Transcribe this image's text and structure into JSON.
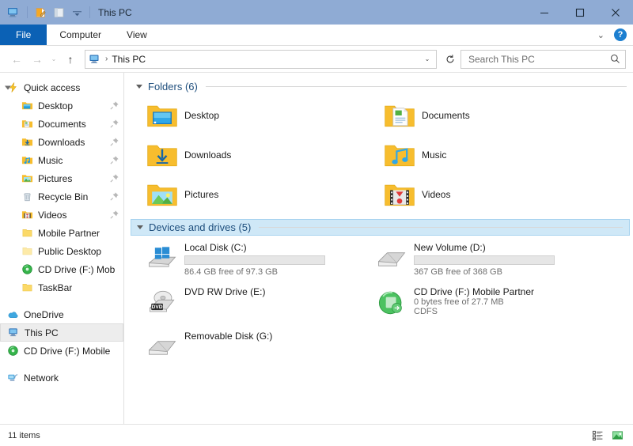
{
  "window": {
    "title": "This PC",
    "qat": [
      {
        "name": "properties-icon",
        "glyph": "properties"
      },
      {
        "name": "new-folder-icon",
        "glyph": "newfolder"
      },
      {
        "name": "customize-qat-dropdown",
        "glyph": "caret"
      }
    ],
    "controls": {
      "minimize": "—",
      "maximize": "☐",
      "close": "✕"
    }
  },
  "ribbon": {
    "tabs": [
      {
        "label": "File",
        "active": true
      },
      {
        "label": "Computer",
        "active": false
      },
      {
        "label": "View",
        "active": false
      }
    ],
    "collapse_label": "⌄",
    "help_label": "?"
  },
  "address": {
    "back_label": "←",
    "forward_label": "→",
    "recent_label": "⌄",
    "up_label": "↑",
    "crumb_separator": "›",
    "crumb": "This PC",
    "dropdown_label": "⌄",
    "refresh_label": "↻"
  },
  "search": {
    "placeholder": "Search This PC",
    "value": ""
  },
  "sidebar": {
    "groups": [
      {
        "name": "quick-access",
        "label": "Quick access",
        "icon": "lightning-icon",
        "expanded": true,
        "items": [
          {
            "label": "Desktop",
            "icon": "desktop-folder-icon",
            "pinned": true
          },
          {
            "label": "Documents",
            "icon": "documents-folder-icon",
            "pinned": true
          },
          {
            "label": "Downloads",
            "icon": "downloads-folder-icon",
            "pinned": true
          },
          {
            "label": "Music",
            "icon": "music-folder-icon",
            "pinned": true
          },
          {
            "label": "Pictures",
            "icon": "pictures-folder-icon",
            "pinned": true
          },
          {
            "label": "Recycle Bin",
            "icon": "recycle-bin-icon",
            "pinned": true
          },
          {
            "label": "Videos",
            "icon": "videos-folder-icon",
            "pinned": true
          },
          {
            "label": "Mobile Partner",
            "icon": "folder-icon",
            "pinned": false,
            "expandable": true
          },
          {
            "label": "Public Desktop",
            "icon": "folder-icon",
            "pinned": false
          },
          {
            "label": "CD Drive (F:) Mob",
            "icon": "cd-drive-icon",
            "pinned": false
          },
          {
            "label": "TaskBar",
            "icon": "folder-icon",
            "pinned": false
          }
        ]
      }
    ],
    "roots": [
      {
        "label": "OneDrive",
        "icon": "onedrive-icon",
        "selected": false
      },
      {
        "label": "This PC",
        "icon": "this-pc-icon",
        "selected": true
      },
      {
        "label": "CD Drive (F:) Mobile",
        "icon": "cd-drive-icon",
        "selected": false
      },
      {
        "label": "Network",
        "icon": "network-icon",
        "selected": false
      }
    ]
  },
  "main": {
    "folders_group": {
      "label": "Folders (6)",
      "selected": false,
      "items": [
        {
          "name": "Desktop",
          "icon": "desktop-folder-icon"
        },
        {
          "name": "Documents",
          "icon": "documents-folder-icon"
        },
        {
          "name": "Downloads",
          "icon": "downloads-folder-icon"
        },
        {
          "name": "Music",
          "icon": "music-folder-icon"
        },
        {
          "name": "Pictures",
          "icon": "pictures-folder-icon"
        },
        {
          "name": "Videos",
          "icon": "videos-folder-icon"
        }
      ]
    },
    "drives_group": {
      "label": "Devices and drives (5)",
      "selected": true,
      "items": [
        {
          "name": "Local Disk (C:)",
          "icon": "windows-drive-icon",
          "has_bar": true,
          "used_percent": 11,
          "capacity_text": "86.4 GB free of 97.3 GB",
          "extra": ""
        },
        {
          "name": "New Volume (D:)",
          "icon": "hard-drive-icon",
          "has_bar": true,
          "used_percent": 0,
          "capacity_text": "367 GB free of 368 GB",
          "extra": ""
        },
        {
          "name": "DVD RW Drive (E:)",
          "icon": "dvd-drive-icon",
          "has_bar": false,
          "used_percent": 0,
          "capacity_text": "",
          "extra": ""
        },
        {
          "name": "CD Drive (F:) Mobile Partner",
          "icon": "cd-drive-green-icon",
          "has_bar": false,
          "used_percent": 0,
          "capacity_text": "0 bytes free of 27.7 MB",
          "extra": "CDFS"
        },
        {
          "name": "Removable Disk (G:)",
          "icon": "removable-drive-icon",
          "has_bar": false,
          "used_percent": 0,
          "capacity_text": "",
          "extra": ""
        }
      ]
    }
  },
  "status": {
    "item_count": "11 items",
    "views": [
      {
        "name": "details-view-button",
        "active": false
      },
      {
        "name": "large-icons-view-button",
        "active": true
      }
    ]
  },
  "colors": {
    "titlebar": "#8fabd4",
    "file_tab": "#0b61b5",
    "group_header_text": "#1f4f7d",
    "group_header_selected_bg": "#cfe8f7",
    "progress_blue": "#1a9ae0",
    "folder_yellow": "#fcb913"
  }
}
